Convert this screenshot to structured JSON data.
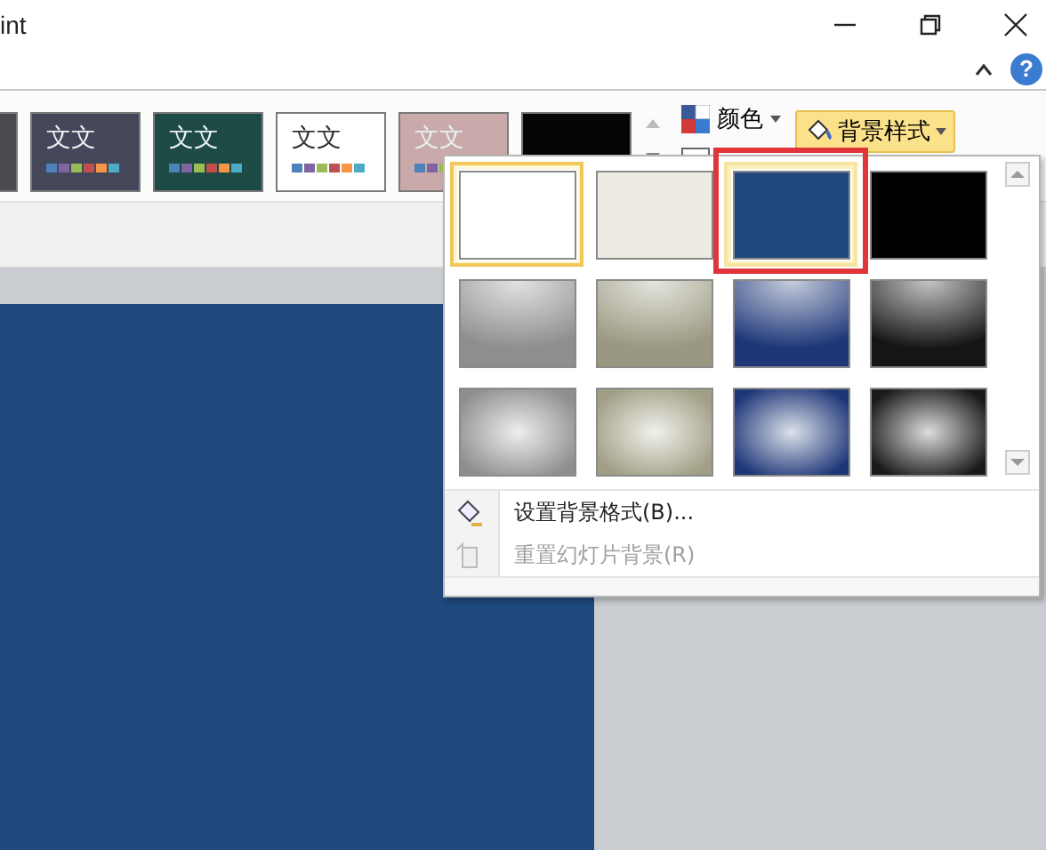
{
  "window": {
    "title": "int"
  },
  "ribbon": {
    "themes": [
      {
        "color": "#4a4a50"
      },
      {
        "color": "#44475a",
        "text": "文文"
      },
      {
        "color": "#1d4a44",
        "text": "文文"
      },
      {
        "color": "#ffffff",
        "text": "文文"
      },
      {
        "color": "#c9a9a9",
        "text": "文文"
      },
      {
        "color": "#050505"
      }
    ],
    "help_button": {
      "label": "?"
    },
    "colors_button": {
      "label": "颜色"
    },
    "background_styles_button": {
      "label": "背景样式",
      "expanded": true
    }
  },
  "gallery": {
    "swatches": [
      {
        "kind": "solid",
        "color": "#ffffff",
        "selected": true,
        "hovered": false,
        "marked": false
      },
      {
        "kind": "solid",
        "color": "#eeebe2",
        "selected": false,
        "hovered": false,
        "marked": false
      },
      {
        "kind": "solid",
        "color": "#1f487c",
        "selected": false,
        "hovered": true,
        "marked": true
      },
      {
        "kind": "solid",
        "color": "#000000",
        "selected": false,
        "hovered": false,
        "marked": false
      },
      {
        "kind": "top-glow",
        "color": "#8e8e8e",
        "selected": false,
        "hovered": false,
        "marked": false
      },
      {
        "kind": "top-glow",
        "color": "#9a9880",
        "selected": false,
        "hovered": false,
        "marked": false
      },
      {
        "kind": "top-glow",
        "color": "#1c3677",
        "selected": false,
        "hovered": false,
        "marked": false
      },
      {
        "kind": "top-glow",
        "color": "#151515",
        "selected": false,
        "hovered": false,
        "marked": false
      },
      {
        "kind": "center-glow",
        "color": "#8e8e8e",
        "selected": false,
        "hovered": false,
        "marked": false
      },
      {
        "kind": "center-glow",
        "color": "#a09e84",
        "selected": false,
        "hovered": false,
        "marked": false
      },
      {
        "kind": "center-glow",
        "color": "#1c3677",
        "selected": false,
        "hovered": false,
        "marked": false
      },
      {
        "kind": "center-glow",
        "color": "#1a1a1a",
        "selected": false,
        "hovered": false,
        "marked": false
      }
    ],
    "menu_items": [
      {
        "label": "设置背景格式(B)...",
        "disabled": false
      },
      {
        "label": "重置幻灯片背景(R)",
        "disabled": true
      }
    ]
  }
}
